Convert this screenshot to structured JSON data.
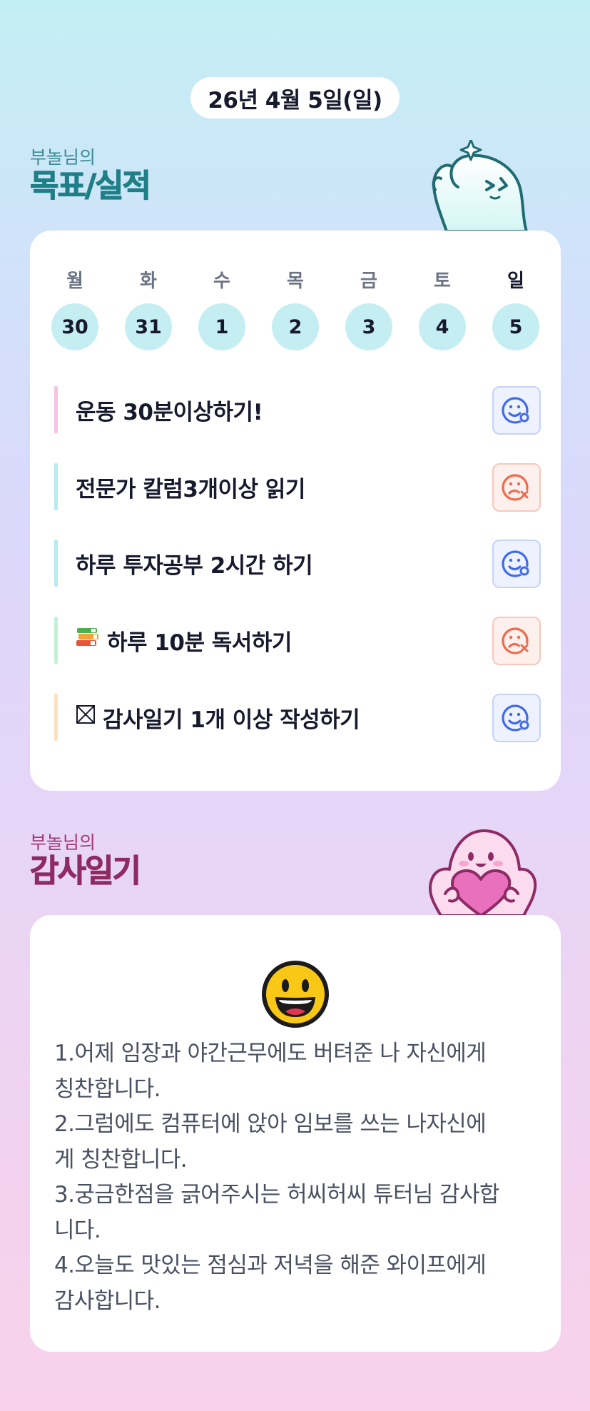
{
  "header": {
    "date": "26년 4월 5일(일)"
  },
  "goals_section": {
    "owner": "부놀님의",
    "title": "목표/실적"
  },
  "week": [
    {
      "name": "월",
      "date": "30",
      "today": false
    },
    {
      "name": "화",
      "date": "31",
      "today": false
    },
    {
      "name": "수",
      "date": "1",
      "today": false
    },
    {
      "name": "목",
      "date": "2",
      "today": false
    },
    {
      "name": "금",
      "date": "3",
      "today": false
    },
    {
      "name": "토",
      "date": "4",
      "today": false
    },
    {
      "name": "일",
      "date": "5",
      "today": true
    }
  ],
  "goals": [
    {
      "label": "운동 30분이상하기!",
      "icon": "",
      "status": "success",
      "accent": "#f6c2e3"
    },
    {
      "label": "전문가 칼럼3개이상 읽기",
      "icon": "",
      "status": "fail",
      "accent": "#b7ebf0"
    },
    {
      "label": "하루 투자공부 2시간 하기",
      "icon": "",
      "status": "success",
      "accent": "#b7ebf0"
    },
    {
      "label": "하루 10분 독서하기",
      "icon": "books-icon",
      "status": "fail",
      "accent": "#c3efd8"
    },
    {
      "label": "감사일기 1개 이상 작성하기",
      "icon": "checkbox-icon",
      "status": "success",
      "accent": "#fde0c0"
    }
  ],
  "gratitude_section": {
    "owner": "부놀님의",
    "title": "감사일기"
  },
  "gratitude": {
    "mood_icon": "grinning-face-icon",
    "lines": [
      "1.어제 임장과 야간근무에도 버텨준 나 자신에게",
      "칭찬합니다.",
      "2.그럼에도 컴퓨터에 앉아 임보를 쓰는 나자신에",
      "게 칭찬합니다.",
      "3.궁금한점을 긁어주시는 허씨허씨 튜터님 감사합",
      "니다.",
      "4.오늘도 맛있는 점심과 저녁을 해준 와이프에게",
      "감사합니다."
    ]
  },
  "colors": {
    "success": "#3f6bea",
    "fail": "#ef6a4c",
    "goals_title": "#1e7f86",
    "gratitude_title": "#8e2a64"
  }
}
